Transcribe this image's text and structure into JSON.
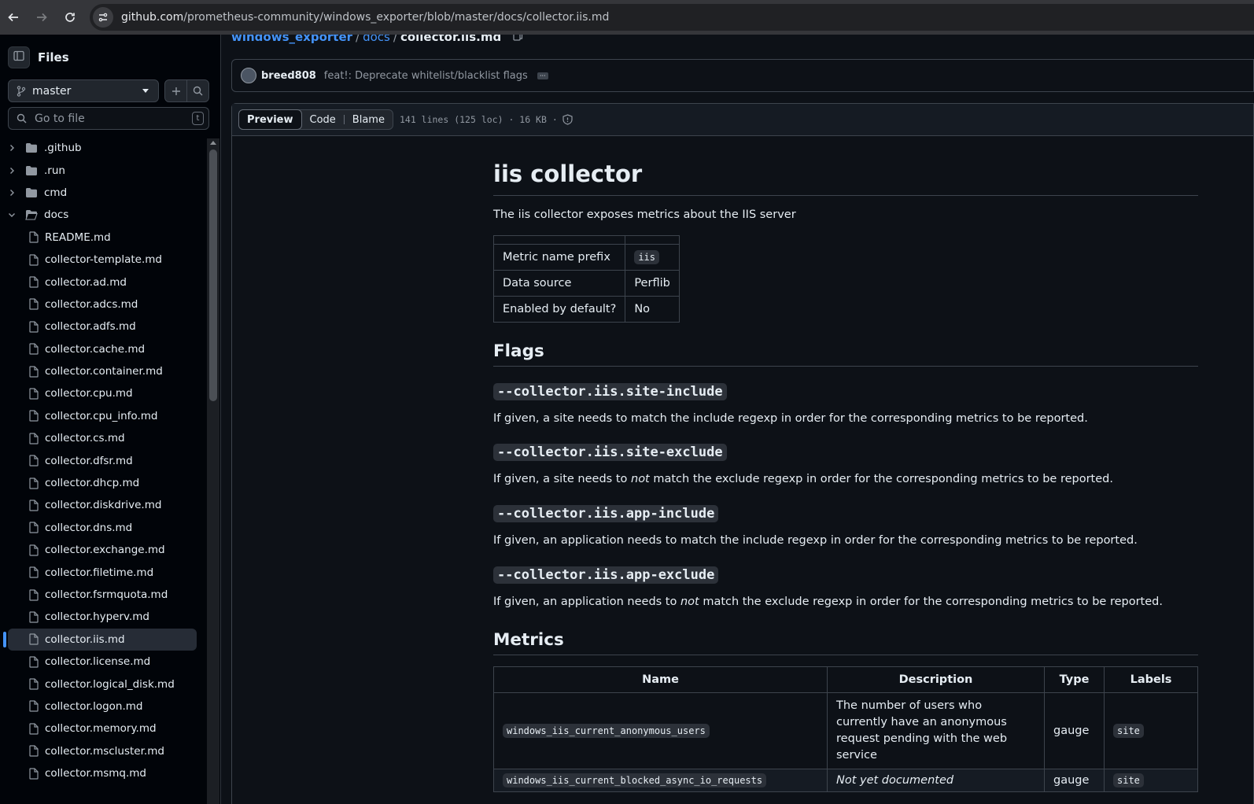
{
  "browser": {
    "url_prefix": "github.com",
    "url_path": "/prometheus-community/windows_exporter/blob/master/docs/collector.iis.md"
  },
  "sidebar": {
    "title": "Files",
    "branch": "master",
    "search_placeholder": "Go to file",
    "search_shortcut": "t",
    "folders": [
      {
        "label": ".github"
      },
      {
        "label": ".run"
      },
      {
        "label": "cmd"
      },
      {
        "label": "docs"
      }
    ],
    "files": [
      {
        "label": "README.md"
      },
      {
        "label": "collector-template.md"
      },
      {
        "label": "collector.ad.md"
      },
      {
        "label": "collector.adcs.md"
      },
      {
        "label": "collector.adfs.md"
      },
      {
        "label": "collector.cache.md"
      },
      {
        "label": "collector.container.md"
      },
      {
        "label": "collector.cpu.md"
      },
      {
        "label": "collector.cpu_info.md"
      },
      {
        "label": "collector.cs.md"
      },
      {
        "label": "collector.dfsr.md"
      },
      {
        "label": "collector.dhcp.md"
      },
      {
        "label": "collector.diskdrive.md"
      },
      {
        "label": "collector.dns.md"
      },
      {
        "label": "collector.exchange.md"
      },
      {
        "label": "collector.filetime.md"
      },
      {
        "label": "collector.fsrmquota.md"
      },
      {
        "label": "collector.hyperv.md"
      },
      {
        "label": "collector.iis.md"
      },
      {
        "label": "collector.license.md"
      },
      {
        "label": "collector.logical_disk.md"
      },
      {
        "label": "collector.logon.md"
      },
      {
        "label": "collector.memory.md"
      },
      {
        "label": "collector.mscluster.md"
      },
      {
        "label": "collector.msmq.md"
      }
    ]
  },
  "breadcrumb": {
    "repo": "windows_exporter",
    "folder": "docs",
    "file": "collector.iis.md"
  },
  "commit": {
    "author": "breed808",
    "message": "feat!: Deprecate whitelist/blacklist flags"
  },
  "file_header": {
    "tabs": [
      "Preview",
      "Code",
      "Blame"
    ],
    "meta": "141 lines (125 loc) · 16 KB ·"
  },
  "doc": {
    "title": "iis collector",
    "intro": "The iis collector exposes metrics about the IIS server",
    "info_table": [
      {
        "key": "Metric name prefix",
        "value": "iis"
      },
      {
        "key": "Data source",
        "value": "Perflib"
      },
      {
        "key": "Enabled by default?",
        "value": "No"
      }
    ],
    "flags_heading": "Flags",
    "flags": [
      {
        "name": "--collector.iis.site-include",
        "pre": "If given, a site needs to match the include regexp in order for the corresponding metrics to be reported.",
        "em": "",
        "post": ""
      },
      {
        "name": "--collector.iis.site-exclude",
        "pre": "If given, a site needs to ",
        "em": "not",
        "post": " match the exclude regexp in order for the corresponding metrics to be reported."
      },
      {
        "name": "--collector.iis.app-include",
        "pre": "If given, an application needs to match the include regexp in order for the corresponding metrics to be reported.",
        "em": "",
        "post": ""
      },
      {
        "name": "--collector.iis.app-exclude",
        "pre": "If given, an application needs to ",
        "em": "not",
        "post": " match the exclude regexp in order for the corresponding metrics to be reported."
      }
    ],
    "metrics_heading": "Metrics",
    "metrics_headers": [
      "Name",
      "Description",
      "Type",
      "Labels"
    ],
    "metrics": [
      {
        "name": "windows_iis_current_anonymous_users",
        "description": "The number of users who currently have an anonymous request pending with the web service",
        "italic": false,
        "type": "gauge",
        "labels": "site"
      },
      {
        "name": "windows_iis_current_blocked_async_io_requests",
        "description": "Not yet documented",
        "italic": true,
        "type": "gauge",
        "labels": "site"
      }
    ]
  }
}
